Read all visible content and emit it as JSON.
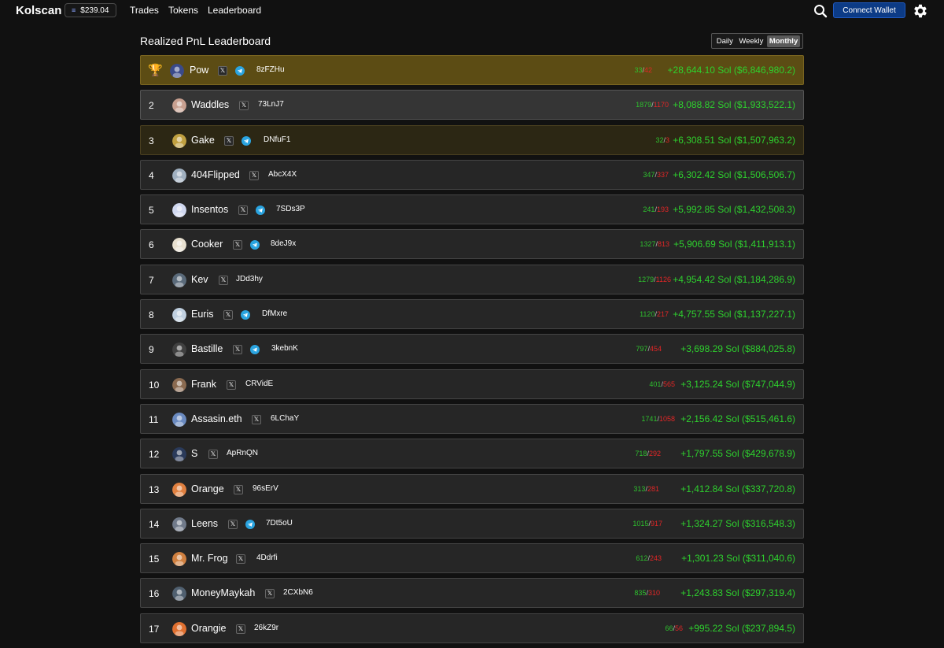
{
  "header": {
    "logo": "Kolscan",
    "sol_price": "$239.04",
    "nav": [
      "Trades",
      "Tokens",
      "Leaderboard"
    ],
    "connect_label": "Connect Wallet"
  },
  "leaderboard": {
    "title": "Realized PnL Leaderboard",
    "periods": [
      "Daily",
      "Weekly",
      "Monthly"
    ],
    "selected_period": "Monthly",
    "rows": [
      {
        "rank": "1",
        "name": "Pow",
        "wallet": "8zFZHu",
        "wins": "33",
        "losses": "42",
        "pnl": "+28,644.10 Sol ($6,846,980.2)",
        "has_telegram": true
      },
      {
        "rank": "2",
        "name": "Waddles",
        "wallet": "73LnJ7",
        "wins": "1879",
        "losses": "1170",
        "pnl": "+8,088.82 Sol ($1,933,522.1)",
        "has_telegram": false
      },
      {
        "rank": "3",
        "name": "Gake",
        "wallet": "DNfuF1",
        "wins": "32",
        "losses": "3",
        "pnl": "+6,308.51 Sol ($1,507,963.2)",
        "has_telegram": true
      },
      {
        "rank": "4",
        "name": "404Flipped",
        "wallet": "AbcX4X",
        "wins": "347",
        "losses": "337",
        "pnl": "+6,302.42 Sol ($1,506,506.7)",
        "has_telegram": false
      },
      {
        "rank": "5",
        "name": "Insentos",
        "wallet": "7SDs3P",
        "wins": "241",
        "losses": "193",
        "pnl": "+5,992.85 Sol ($1,432,508.3)",
        "has_telegram": true
      },
      {
        "rank": "6",
        "name": "Cooker",
        "wallet": "8deJ9x",
        "wins": "1327",
        "losses": "813",
        "pnl": "+5,906.69 Sol ($1,411,913.1)",
        "has_telegram": true
      },
      {
        "rank": "7",
        "name": "Kev",
        "wallet": "JDd3hy",
        "wins": "1279",
        "losses": "1126",
        "pnl": "+4,954.42 Sol ($1,184,286.9)",
        "has_telegram": false
      },
      {
        "rank": "8",
        "name": "Euris",
        "wallet": "DfMxre",
        "wins": "1120",
        "losses": "217",
        "pnl": "+4,757.55 Sol ($1,137,227.1)",
        "has_telegram": true
      },
      {
        "rank": "9",
        "name": "Bastille",
        "wallet": "3kebnK",
        "wins": "797",
        "losses": "454",
        "pnl": "+3,698.29 Sol ($884,025.8)",
        "has_telegram": true
      },
      {
        "rank": "10",
        "name": "Frank",
        "wallet": "CRVidE",
        "wins": "401",
        "losses": "565",
        "pnl": "+3,125.24 Sol ($747,044.9)",
        "has_telegram": false
      },
      {
        "rank": "11",
        "name": "Assasin.eth",
        "wallet": "6LChaY",
        "wins": "1741",
        "losses": "1058",
        "pnl": "+2,156.42 Sol ($515,461.6)",
        "has_telegram": false
      },
      {
        "rank": "12",
        "name": "S",
        "wallet": "ApRnQN",
        "wins": "718",
        "losses": "292",
        "pnl": "+1,797.55 Sol ($429,678.9)",
        "has_telegram": false
      },
      {
        "rank": "13",
        "name": "Orange",
        "wallet": "96sErV",
        "wins": "313",
        "losses": "281",
        "pnl": "+1,412.84 Sol ($337,720.8)",
        "has_telegram": false
      },
      {
        "rank": "14",
        "name": "Leens",
        "wallet": "7Dt5oU",
        "wins": "1015",
        "losses": "917",
        "pnl": "+1,324.27 Sol ($316,548.3)",
        "has_telegram": true
      },
      {
        "rank": "15",
        "name": "Mr. Frog",
        "wallet": "4Ddrfi",
        "wins": "612",
        "losses": "243",
        "pnl": "+1,301.23 Sol ($311,040.6)",
        "has_telegram": false
      },
      {
        "rank": "16",
        "name": "MoneyMaykah",
        "wallet": "2CXbN6",
        "wins": "835",
        "losses": "310",
        "pnl": "+1,243.83 Sol ($297,319.4)",
        "has_telegram": false
      },
      {
        "rank": "17",
        "name": "Orangie",
        "wallet": "26kZ9r",
        "wins": "66",
        "losses": "56",
        "pnl": "+995.22 Sol ($237,894.5)",
        "has_telegram": false
      }
    ]
  },
  "avatar_colors": [
    "#3a4a8a",
    "#c8a090",
    "#c0a040",
    "#a0b0c0",
    "#d0d8f0",
    "#e8e0d0",
    "#5a6a7a",
    "#c0d0e0",
    "#404040",
    "#8a6a50",
    "#6a8ac0",
    "#2a3a5a",
    "#e08040",
    "#707a8a",
    "#d08040",
    "#506070",
    "#e07030"
  ],
  "colors": {
    "win": "#2ec02e",
    "loss": "#e02626",
    "pnl": "#2ed12e",
    "gold": "#5c4c14"
  }
}
